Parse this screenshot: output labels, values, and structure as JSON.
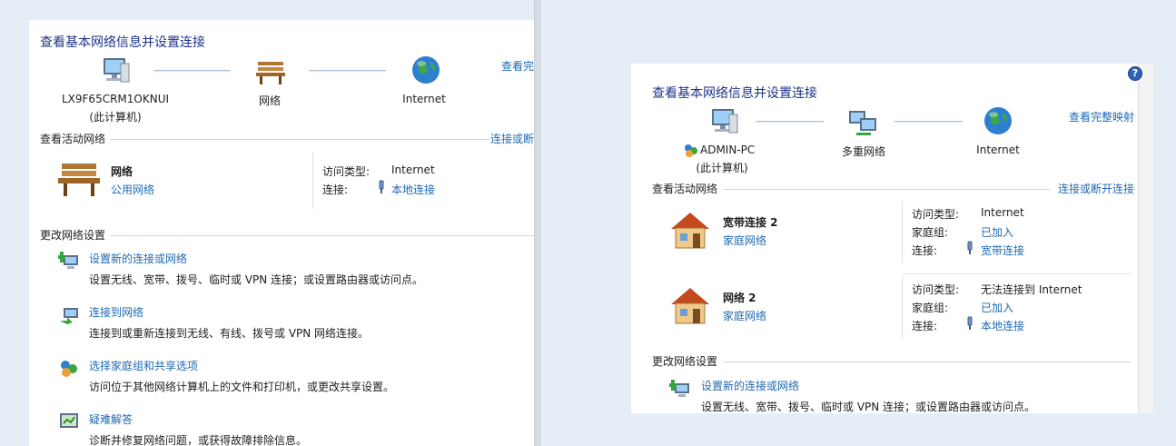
{
  "left": {
    "title": "查看基本网络信息并设置连接",
    "view_full_map": "查看完",
    "map": {
      "computer_name": "LX9F65CRM1OKNUI",
      "computer_note": "(此计算机)",
      "network_label": "网络",
      "internet_label": "Internet"
    },
    "active_networks_heading": "查看活动网络",
    "connect_disconnect": "连接或断",
    "network": {
      "name": "网络",
      "type": "公用网络",
      "access_type_label": "访问类型:",
      "access_type_value": "Internet",
      "connection_label": "连接:",
      "connection_value": "本地连接"
    },
    "change_settings_heading": "更改网络设置",
    "tasks": [
      {
        "title": "设置新的连接或网络",
        "desc": "设置无线、宽带、拨号、临时或 VPN 连接；或设置路由器或访问点。"
      },
      {
        "title": "连接到网络",
        "desc": "连接到或重新连接到无线、有线、拨号或 VPN 网络连接。"
      },
      {
        "title": "选择家庭组和共享选项",
        "desc": "访问位于其他网络计算机上的文件和打印机，或更改共享设置。"
      },
      {
        "title": "疑难解答",
        "desc": "诊断并修复网络问题，或获得故障排除信息。"
      }
    ]
  },
  "right": {
    "help": "?",
    "title": "查看基本网络信息并设置连接",
    "view_full_map": "查看完整映射",
    "map": {
      "computer_name": "ADMIN-PC",
      "computer_note": "(此计算机)",
      "network_label": "多重网络",
      "internet_label": "Internet"
    },
    "active_networks_heading": "查看活动网络",
    "connect_disconnect": "连接或断开连接",
    "networks": [
      {
        "name": "宽带连接  2",
        "type": "家庭网络",
        "access_type_label": "访问类型:",
        "access_type_value": "Internet",
        "homegroup_label": "家庭组:",
        "homegroup_value": "已加入",
        "connection_label": "连接:",
        "connection_value": "宽带连接"
      },
      {
        "name": "网络  2",
        "type": "家庭网络",
        "access_type_label": "访问类型:",
        "access_type_value": "无法连接到 Internet",
        "homegroup_label": "家庭组:",
        "homegroup_value": "已加入",
        "connection_label": "连接:",
        "connection_value": "本地连接"
      }
    ],
    "change_settings_heading": "更改网络设置",
    "tasks": [
      {
        "title": "设置新的连接或网络",
        "desc": "设置无线、宽带、拨号、临时或 VPN 连接；或设置路由器或访问点。"
      }
    ]
  },
  "colors": {
    "title": "#1e3287",
    "link": "#1e69b4",
    "background": "#e5eef7"
  }
}
